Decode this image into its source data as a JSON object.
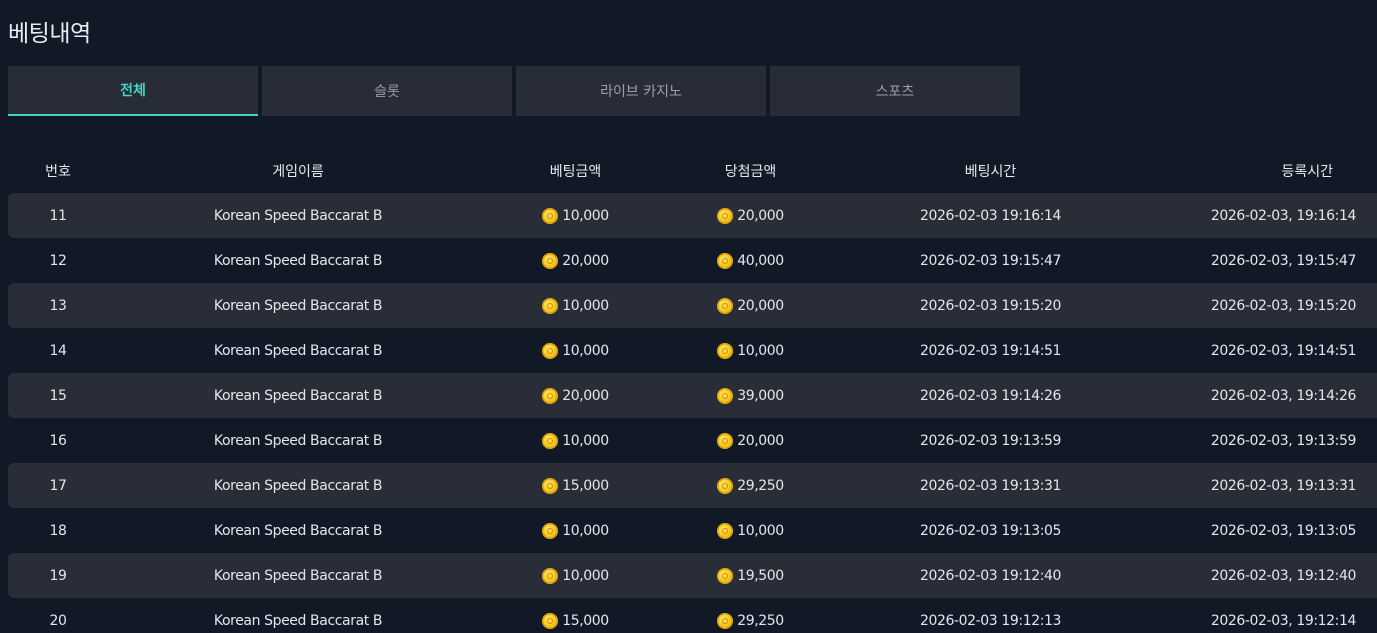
{
  "page_title": "베팅내역",
  "tabs": [
    {
      "label": "전체",
      "active": true
    },
    {
      "label": "슬롯",
      "active": false
    },
    {
      "label": "라이브 카지노",
      "active": false
    },
    {
      "label": "스포츠",
      "active": false
    }
  ],
  "colors": {
    "accent": "#3fd6c4",
    "background": "#121926",
    "row_alt": "#292d37",
    "tab_bg": "#272c36"
  },
  "table": {
    "headers": {
      "num": "번호",
      "game": "게임이름",
      "bet_amount": "베팅금액",
      "win_amount": "당첨금액",
      "bet_time": "베팅시간",
      "reg_time": "등록시간"
    },
    "coin_icon": "gold-coin-icon",
    "rows": [
      {
        "num": "11",
        "game": "Korean Speed Baccarat B",
        "bet": "10,000",
        "win": "20,000",
        "bet_time": "2026-02-03 19:16:14",
        "reg_time": "2026-02-03, 19:16:14"
      },
      {
        "num": "12",
        "game": "Korean Speed Baccarat B",
        "bet": "20,000",
        "win": "40,000",
        "bet_time": "2026-02-03 19:15:47",
        "reg_time": "2026-02-03, 19:15:47"
      },
      {
        "num": "13",
        "game": "Korean Speed Baccarat B",
        "bet": "10,000",
        "win": "20,000",
        "bet_time": "2026-02-03 19:15:20",
        "reg_time": "2026-02-03, 19:15:20"
      },
      {
        "num": "14",
        "game": "Korean Speed Baccarat B",
        "bet": "10,000",
        "win": "10,000",
        "bet_time": "2026-02-03 19:14:51",
        "reg_time": "2026-02-03, 19:14:51"
      },
      {
        "num": "15",
        "game": "Korean Speed Baccarat B",
        "bet": "20,000",
        "win": "39,000",
        "bet_time": "2026-02-03 19:14:26",
        "reg_time": "2026-02-03, 19:14:26"
      },
      {
        "num": "16",
        "game": "Korean Speed Baccarat B",
        "bet": "10,000",
        "win": "20,000",
        "bet_time": "2026-02-03 19:13:59",
        "reg_time": "2026-02-03, 19:13:59"
      },
      {
        "num": "17",
        "game": "Korean Speed Baccarat B",
        "bet": "15,000",
        "win": "29,250",
        "bet_time": "2026-02-03 19:13:31",
        "reg_time": "2026-02-03, 19:13:31"
      },
      {
        "num": "18",
        "game": "Korean Speed Baccarat B",
        "bet": "10,000",
        "win": "10,000",
        "bet_time": "2026-02-03 19:13:05",
        "reg_time": "2026-02-03, 19:13:05"
      },
      {
        "num": "19",
        "game": "Korean Speed Baccarat B",
        "bet": "10,000",
        "win": "19,500",
        "bet_time": "2026-02-03 19:12:40",
        "reg_time": "2026-02-03, 19:12:40"
      },
      {
        "num": "20",
        "game": "Korean Speed Baccarat B",
        "bet": "15,000",
        "win": "29,250",
        "bet_time": "2026-02-03 19:12:13",
        "reg_time": "2026-02-03, 19:12:14"
      }
    ]
  }
}
